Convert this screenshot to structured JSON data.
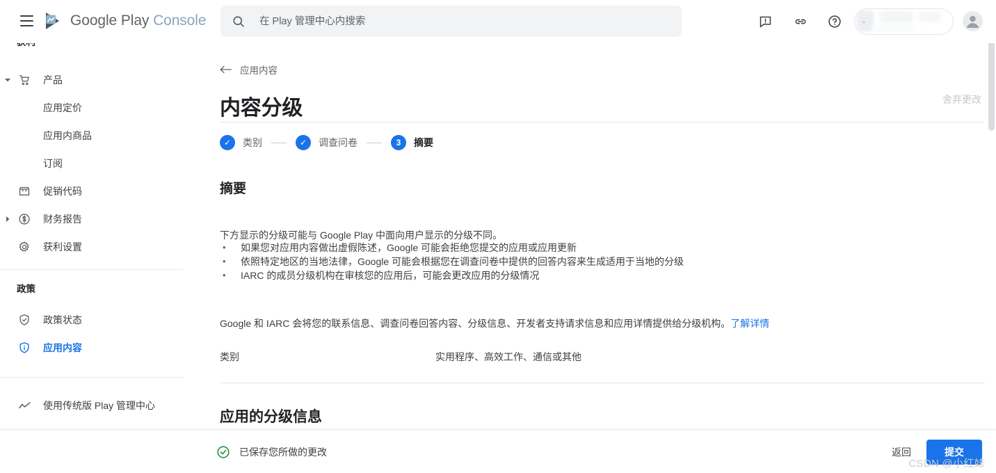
{
  "brand": {
    "google": "Google Play",
    "console": "Console",
    "logo_icon": "play-console-logo-icon",
    "menu_icon": "hamburger-menu-icon"
  },
  "search": {
    "placeholder": "在 Play 管理中心内搜索",
    "value": "",
    "icon": "search-icon"
  },
  "topbar": {
    "feedback_icon": "feedback-icon",
    "link_icon": "link-icon",
    "help_icon": "help-circle-icon",
    "app_selector_label": "",
    "avatar_icon": "account-avatar-icon"
  },
  "sidebar": {
    "section_monetize": "获利",
    "section_policy": "政策",
    "items": [
      {
        "label": "产品",
        "icon": "shopping-cart-icon",
        "expandable": true,
        "expanded": true,
        "sub": false,
        "active": false
      },
      {
        "label": "应用定价",
        "icon": "",
        "expandable": false,
        "expanded": false,
        "sub": true,
        "active": false
      },
      {
        "label": "应用内商品",
        "icon": "",
        "expandable": false,
        "expanded": false,
        "sub": true,
        "active": false
      },
      {
        "label": "订阅",
        "icon": "",
        "expandable": false,
        "expanded": false,
        "sub": true,
        "active": false
      },
      {
        "label": "促销代码",
        "icon": "store-icon",
        "expandable": false,
        "expanded": false,
        "sub": false,
        "active": false
      },
      {
        "label": "财务报告",
        "icon": "dollar-circle-icon",
        "expandable": true,
        "expanded": false,
        "sub": false,
        "active": false
      },
      {
        "label": "获利设置",
        "icon": "gear-icon",
        "expandable": false,
        "expanded": false,
        "sub": false,
        "active": false
      }
    ],
    "policy_items": [
      {
        "label": "政策状态",
        "icon": "shield-check-icon",
        "active": false
      },
      {
        "label": "应用内容",
        "icon": "info-shield-icon",
        "active": true
      }
    ],
    "legacy": {
      "label": "使用传统版 Play 管理中心",
      "icon": "trend-line-icon"
    }
  },
  "page": {
    "breadcrumb": "应用内容",
    "back_icon": "arrow-left-icon",
    "title": "内容分级",
    "discard_label": "舍弃更改"
  },
  "stepper": {
    "steps": [
      {
        "label": "类别",
        "marker": "✓",
        "state": "complete"
      },
      {
        "label": "调查问卷",
        "marker": "✓",
        "state": "complete"
      },
      {
        "label": "摘要",
        "marker": "3",
        "state": "current"
      }
    ]
  },
  "summary": {
    "heading": "摘要",
    "intro": "下方显示的分级可能与 Google Play 中面向用户显示的分级不同。",
    "bullets": [
      "如果您对应用内容做出虚假陈述，Google 可能会拒绝您提交的应用或应用更新",
      "依照特定地区的当地法律，Google 可能会根据您在调查问卷中提供的回答内容来生成适用于当地的分级",
      "IARC 的成员分级机构在审核您的应用后，可能会更改应用的分级情况"
    ],
    "consent_text": "Google 和 IARC 会将您的联系信息、调查问卷回答内容、分级信息、开发者支持请求信息和应用详情提供给分级机构。",
    "consent_link": "了解详情",
    "category_key": "类别",
    "category_value": "实用程序、高效工作、通信或其他",
    "ratings_heading": "应用的分级信息"
  },
  "footer": {
    "saved_text": "已保存您所做的更改",
    "saved_icon": "check-circle-icon",
    "back_label": "返回",
    "submit_label": "提交"
  },
  "watermark": "CSDN @小红妹",
  "colors": {
    "accent": "#1a73e8",
    "success": "#1e8e3e",
    "text_primary": "#202124",
    "text_secondary": "#5f6368",
    "divider": "#e4e6e9"
  },
  "scrollbar": {
    "position": "right",
    "thumb_visible": true
  }
}
